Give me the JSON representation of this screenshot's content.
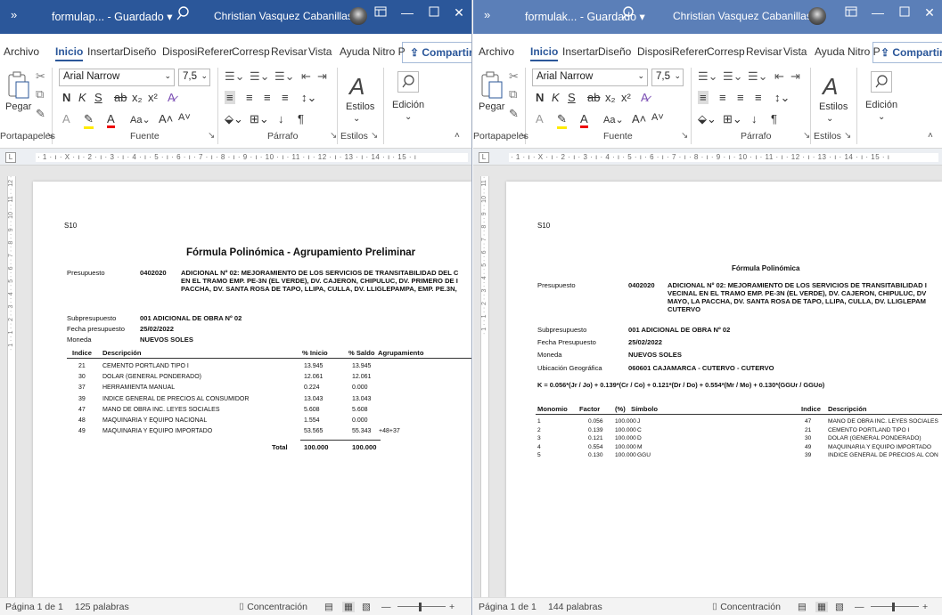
{
  "colors": {
    "brand": "#2b579a",
    "titlebar_text": "#ffffff"
  },
  "windows": [
    {
      "id": "w1",
      "title": {
        "arrows": "»",
        "doc": "formulap... - Guardado ▾",
        "user": "Christian Vasquez Cabanillas"
      },
      "menu": {
        "items": [
          "Archivo",
          "Inicio",
          "Insertar",
          "Diseño",
          "Disposi",
          "Referer",
          "Corresp",
          "Revisar",
          "Vista",
          "Ayuda",
          "Nitro P"
        ],
        "share": "Compartir"
      },
      "ribbon": {
        "font": "Arial Narrow",
        "size": "7,5",
        "paste": "Pegar",
        "styles": "Estilos",
        "edit": "Edición",
        "groups": [
          "Portapapeles",
          "Fuente",
          "Párrafo",
          "Estilos"
        ]
      },
      "ruler": "· 1 · ı · X · ı · 2 · ı · 3 · ı · 4 · ı · 5 · ı · 6 · ı · 7 · ı · 8 · ı · 9 · ı · 10 · ı · 11 · ı · 12 · ı · 13 · ı · 14 · ı · 15 · ı",
      "vruler": "· 1 · · 1 · · 2 · · 3 · · 4 · · 5 · · 6 · · 7 · · 8 · · 9 · · 10 · · 11 · · 12 ·",
      "status": {
        "page": "Página 1 de 1",
        "words": "125 palabras",
        "focus": "Concentración",
        "zoom": "100%"
      },
      "doc": {
        "code": "S10",
        "title": "Fórmula Polinómica - Agrupamiento Preliminar",
        "presupuesto_label": "Presupuesto",
        "presupuesto_code": "0402020",
        "presupuesto_lines": [
          "ADICIONAL Nº 02: MEJORAMIENTO DE LOS SERVICIOS DE TRANSITABILIDAD DEL C",
          "EN EL TRAMO EMP. PE-3N (EL VERDE), DV. CAJERON, CHIPULUC, DV. PRIMERO DE I",
          "PACCHA, DV. SANTA ROSA DE TAPO, LLIPA, CULLA, DV. LLIGLEPAMPA, EMP. PE.3N,"
        ],
        "sub_label": "Subpresupuesto",
        "sub_value": "001  ADICIONAL DE OBRA Nº 02",
        "fecha_label": "Fecha presupuesto",
        "fecha_value": "25/02/2022",
        "moneda_label": "Moneda",
        "moneda_value": "NUEVOS SOLES",
        "headers": [
          "Indice",
          "Descripción",
          "% Inicio",
          "% Saldo",
          "Agrupamiento"
        ],
        "rows": [
          [
            "21",
            "CEMENTO PORTLAND TIPO I",
            "13.945",
            "13.945",
            ""
          ],
          [
            "30",
            "DOLAR (GENERAL PONDERADO)",
            "12.061",
            "12.061",
            ""
          ],
          [
            "37",
            "HERRAMIENTA MANUAL",
            "0.224",
            "0.000",
            ""
          ],
          [
            "39",
            "INDICE GENERAL DE PRECIOS AL CONSUMIDOR",
            "13.043",
            "13.043",
            ""
          ],
          [
            "47",
            "MANO DE OBRA INC. LEYES SOCIALES",
            "5.608",
            "5.608",
            ""
          ],
          [
            "48",
            "MAQUINARIA Y EQUIPO NACIONAL",
            "1.554",
            "0.000",
            ""
          ],
          [
            "49",
            "MAQUINARIA Y EQUIPO IMPORTADO",
            "53.565",
            "55.343",
            "+48+37"
          ]
        ],
        "total_label": "Total",
        "total_inicio": "100.000",
        "total_saldo": "100.000"
      }
    },
    {
      "id": "w2",
      "title": {
        "arrows": "»",
        "doc": "formulak... - Guardado ▾",
        "user": "Christian Vasquez Cabanillas"
      },
      "menu": {
        "items": [
          "Archivo",
          "Inicio",
          "Insertar",
          "Diseño",
          "Disposi",
          "Referer",
          "Corresp",
          "Revisar",
          "Vista",
          "Ayuda",
          "Nitro P"
        ],
        "share": "Compartir"
      },
      "ribbon": {
        "font": "Arial Narrow",
        "size": "7,5",
        "paste": "Pegar",
        "styles": "Estilos",
        "edit": "Edición",
        "groups": [
          "Portapapeles",
          "Fuente",
          "Párrafo",
          "Estilos"
        ]
      },
      "ruler": "· 1 · ı · X · ı · 2 · ı · 3 · ı · 4 · ı · 5 · ı · 6 · ı · 7 · ı · 8 · ı · 9 · ı · 10 · ı · 11 · ı · 12 · ı · 13 · ı · 14 · ı · 15 · ı",
      "vruler": "· 1 · · 1 · · 2 · · 3 · · 4 · · 5 · · 6 · · 7 · · 8 · · 9 · · 10 · · 11 ·",
      "status": {
        "page": "Página 1 de 1",
        "words": "144 palabras",
        "focus": "Concentración",
        "zoom": "100%"
      },
      "doc": {
        "code": "S10",
        "title": "Fórmula Polinómica",
        "presupuesto_label": "Presupuesto",
        "presupuesto_code": "0402020",
        "presupuesto_lines": [
          "ADICIONAL Nº 02: MEJORAMIENTO DE LOS SERVICIOS DE TRANSITABILIDAD I",
          "VECINAL EN EL TRAMO EMP. PE-3N (EL VERDE), DV. CAJERON, CHIPULUC, DV",
          "MAYO, LA PACCHA, DV. SANTA ROSA DE TAPO, LLIPA, CULLA, DV. LLIGLEPAM",
          "CUTERVO"
        ],
        "sub_label": "Subpresupuesto",
        "sub_value": "001  ADICIONAL DE OBRA Nº 02",
        "fecha_label": "Fecha Presupuesto",
        "fecha_value": "25/02/2022",
        "moneda_label": "Moneda",
        "moneda_value": "NUEVOS SOLES",
        "ubic_label": "Ubicación Geográfica",
        "ubic_value": "060601   CAJAMARCA   - CUTERVO - CUTERVO",
        "formula": "K =   0.056*(Jr / Jo) + 0.139*(Cr / Co) + 0.121*(Dr / Do) + 0.554*(Mr / Mo) + 0.130*(GGUr / GGUo)",
        "headers": [
          "Monomio",
          "Factor",
          "(%)",
          "Símbolo",
          "Indice",
          "Descripción"
        ],
        "rows": [
          [
            "1",
            "0.056",
            "100.000",
            "J",
            "47",
            "MANO DE OBRA INC. LEYES SOCIALES"
          ],
          [
            "2",
            "0.139",
            "100.000",
            "C",
            "21",
            "CEMENTO PORTLAND TIPO I"
          ],
          [
            "3",
            "0.121",
            "100.000",
            "D",
            "30",
            "DOLAR (GENERAL PONDERADO)"
          ],
          [
            "4",
            "0.554",
            "100.000",
            "M",
            "49",
            "MAQUINARIA Y EQUIPO IMPORTADO"
          ],
          [
            "5",
            "0.130",
            "100.000",
            "GGU",
            "39",
            "INDICE GENERAL DE PRECIOS AL CON"
          ]
        ]
      }
    }
  ]
}
